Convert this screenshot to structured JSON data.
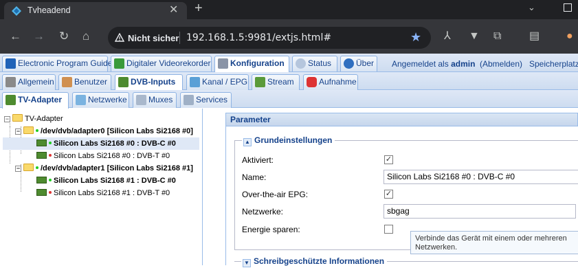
{
  "browser": {
    "tab_title": "Tvheadend",
    "security_label": "Nicht sicher",
    "url": "192.168.1.5:9981/extjs.html#"
  },
  "main_tabs": [
    "Electronic Program Guide",
    "Digitaler Videorekorder",
    "Konfiguration",
    "Status",
    "Über"
  ],
  "login": {
    "prefix": "Angemeldet als",
    "user": "admin",
    "logout": "(Abmelden)",
    "storage": "Speicherplatz:"
  },
  "config_tabs": [
    "Allgemein",
    "Benutzer",
    "DVB-Inputs",
    "Kanal / EPG",
    "Stream",
    "Aufnahme"
  ],
  "dvb_tabs": [
    "TV-Adapter",
    "Netzwerke",
    "Muxes",
    "Services"
  ],
  "tree": {
    "root": "TV-Adapter",
    "adapter0": "/dev/dvb/adapter0 [Silicon Labs Si2168 #0]",
    "a0_c": "Silicon Labs Si2168 #0 : DVB-C #0",
    "a0_t": "Silicon Labs Si2168 #0 : DVB-T #0",
    "adapter1": "/dev/dvb/adapter1 [Silicon Labs Si2168 #1]",
    "a1_c": "Silicon Labs Si2168 #1 : DVB-C #0",
    "a1_t": "Silicon Labs Si2168 #1 : DVB-T #0"
  },
  "params": {
    "header": "Parameter",
    "section1": "Grundeinstellungen",
    "enabled_label": "Aktiviert:",
    "name_label": "Name:",
    "name_value": "Silicon Labs Si2168 #0 : DVB-C #0",
    "ota_label": "Over-the-air EPG:",
    "networks_label": "Netzwerke:",
    "networks_value": "sbgag",
    "power_label": "Energie sparen:",
    "tooltip": "Verbinde das Gerät mit einem oder mehreren Netzwerken.",
    "section2": "Schreibgeschützte Informationen"
  }
}
